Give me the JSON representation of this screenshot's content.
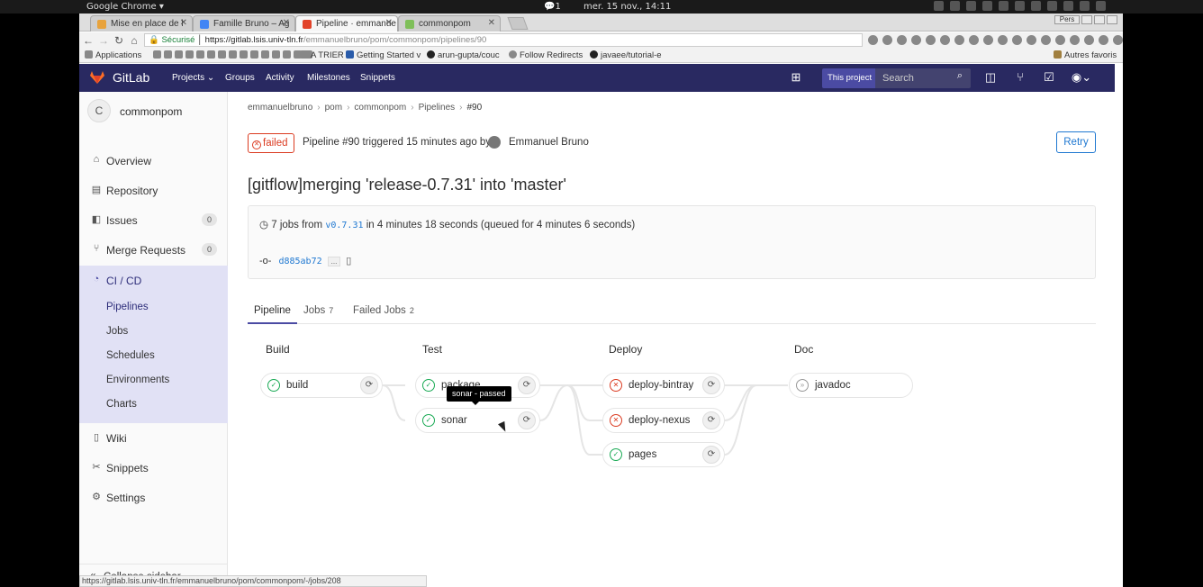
{
  "os": {
    "app_menu": "Google Chrome ▾",
    "notif_count": "1",
    "datetime": "mer. 15 nov., 14:11"
  },
  "tabs": [
    {
      "label": "Mise en place de l",
      "color": "#e8a33d"
    },
    {
      "label": "Famille Bruno – Ag",
      "color": "#4285f4"
    },
    {
      "label": "Pipeline · emmanue",
      "color": "#e24329"
    },
    {
      "label": "commonpom",
      "color": "#7fbf5a"
    }
  ],
  "window_controls": {
    "persona": "Pers"
  },
  "omnibox": {
    "secure": "Sécurisé",
    "host": "https://gitlab.lsis.univ-tln.fr",
    "path": "/emmanuelbruno/pom/commonpom/pipelines/90"
  },
  "bookmarks": [
    {
      "label": "Applications"
    },
    {
      "label": "A TRIER"
    },
    {
      "label": "Getting Started v"
    },
    {
      "label": "arun-gupta/couc"
    },
    {
      "label": "Follow Redirects"
    },
    {
      "label": "javaee/tutorial-e"
    },
    {
      "label": "Autres favoris"
    }
  ],
  "gitlab": {
    "brand": "GitLab",
    "nav": {
      "projects": "Projects ⌄",
      "groups": "Groups",
      "activity": "Activity",
      "milestones": "Milestones",
      "snippets": "Snippets"
    },
    "this_project": "This project",
    "search_placeholder": "Search"
  },
  "sidebar": {
    "avatar_letter": "C",
    "project_name": "commonpom",
    "overview": "Overview",
    "repository": "Repository",
    "issues": "Issues",
    "issues_count": "0",
    "merge_requests": "Merge Requests",
    "mr_count": "0",
    "cicd": "CI / CD",
    "sub": {
      "pipelines": "Pipelines",
      "jobs": "Jobs",
      "schedules": "Schedules",
      "environments": "Environments",
      "charts": "Charts"
    },
    "wiki": "Wiki",
    "snippets": "Snippets",
    "settings": "Settings",
    "collapse": "Collapse sidebar"
  },
  "breadcrumb": [
    "emmanuelbruno",
    "pom",
    "commonpom",
    "Pipelines",
    "#90"
  ],
  "header": {
    "status": "failed",
    "text": "Pipeline #90 triggered 15 minutes ago by",
    "user": "Emmanuel Bruno",
    "retry": "Retry"
  },
  "commit_title": "[gitflow]merging 'release-0.7.31' into 'master'",
  "info": {
    "jobs_from": "7 jobs from",
    "ref": "v0.7.31",
    "duration": "in 4 minutes 18 seconds (queued for 4 minutes 6 seconds)",
    "sha": "d885ab72",
    "dots": "...",
    "copy_icon": "▯"
  },
  "page_tabs": [
    {
      "label": "Pipeline",
      "count": ""
    },
    {
      "label": "Jobs",
      "count": "7"
    },
    {
      "label": "Failed Jobs",
      "count": "2"
    }
  ],
  "stages": [
    {
      "name": "Build"
    },
    {
      "name": "Test"
    },
    {
      "name": "Deploy"
    },
    {
      "name": "Doc"
    }
  ],
  "jobs": {
    "build": {
      "name": "build",
      "status": "success"
    },
    "package": {
      "name": "package",
      "status": "success"
    },
    "sonar": {
      "name": "sonar",
      "status": "success"
    },
    "deploy_bintray": {
      "name": "deploy-bintray",
      "status": "failed"
    },
    "deploy_nexus": {
      "name": "deploy-nexus",
      "status": "failed"
    },
    "pages": {
      "name": "pages",
      "status": "success"
    },
    "javadoc": {
      "name": "javadoc",
      "status": "skipped"
    }
  },
  "tooltip": "sonar - passed",
  "status_url": "https://gitlab.lsis.univ-tln.fr/emmanuelbruno/pom/commonpom/-/jobs/208",
  "colors": {
    "nav": "#292961",
    "accent": "#4b4ba3",
    "success": "#1aaa55",
    "failed": "#db3b21",
    "link": "#1f78d1"
  }
}
